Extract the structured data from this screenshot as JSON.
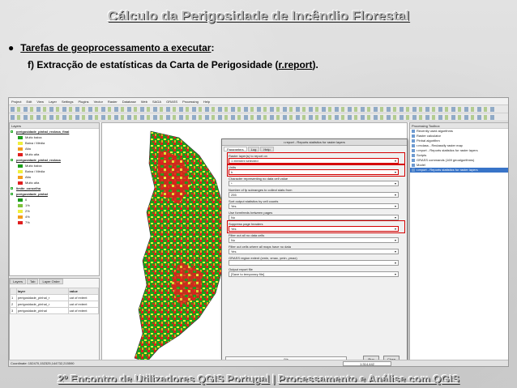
{
  "slide": {
    "title": "Cálculo da Perigosidade de Incêndio Florestal",
    "bullet_link": "Tarefas de geoprocessamento a executar",
    "bullet_suffix": ":",
    "sub_prefix": "f)  Extracção de estatísticas da Carta de Perigosidade (",
    "sub_link": "r.report",
    "sub_suffix": ").",
    "footer_left": "2º Encontro de Utilizadores QGIS Portugal",
    "footer_sep": "|",
    "footer_right": "Processamento e Análise com QGIS"
  },
  "qgis": {
    "menu": [
      "Project",
      "Edit",
      "View",
      "Layer",
      "Settings",
      "Plugins",
      "Vector",
      "Raster",
      "Database",
      "Web",
      "SAGA",
      "GRASS",
      "Processing",
      "Help"
    ],
    "layers_title": "Layers",
    "layers": [
      {
        "name": "perigosidade_pinhal_reclass_final",
        "group": true
      },
      {
        "name": "Muito baixa",
        "color": "#1a9e1a"
      },
      {
        "name": "Baixa / Média",
        "color": "#f0f03c"
      },
      {
        "name": "Alta",
        "color": "#f39c1b"
      },
      {
        "name": "Muito alta",
        "color": "#e01e1e"
      },
      {
        "name": "perigosidade_pinhal_reclass",
        "group": true
      },
      {
        "name": "Muito baixa",
        "color": "#1a9e1a"
      },
      {
        "name": "Baixa / Média",
        "color": "#f0f03c"
      },
      {
        "name": "Alta",
        "color": "#f39c1b"
      },
      {
        "name": "Muito alta",
        "color": "#e01e1e"
      },
      {
        "name": "limite_concelho",
        "group": true
      },
      {
        "name": "perigosidade_pinhal",
        "group": true
      },
      {
        "name": "0",
        "color": "#1a9e1a"
      },
      {
        "name": "1%",
        "color": "#7cc23a"
      },
      {
        "name": "2%",
        "color": "#f0f03c"
      },
      {
        "name": "4%",
        "color": "#f39c1b"
      },
      {
        "name": "7%",
        "color": "#e01e1e"
      }
    ],
    "attr_tabs": [
      "Layers",
      "Tab",
      "Layer Order"
    ],
    "attr_headers": [
      "",
      "layer",
      "value"
    ],
    "attr_rows": [
      [
        "1",
        "perigosidade_pinhal_r",
        "cat of extent"
      ],
      [
        "2",
        "perigosidade_pinhal_r",
        "cat of extent"
      ],
      [
        "3",
        "perigosidade_pinhal",
        "cat of extent"
      ]
    ],
    "dialog": {
      "title": "r.report - Reports statistics for raster layers",
      "tabs": [
        "Parameters",
        "Log",
        "Help"
      ],
      "fields": [
        {
          "label": "Raster layer(s) to report on",
          "value": "1 element selected",
          "hl": true
        },
        {
          "label": "Units",
          "value": "h",
          "hl": true
        },
        {
          "label": "Character representing no data cell value",
          "value": "*"
        },
        {
          "label": "Number of fp subranges to collect stats from",
          "value": "255"
        },
        {
          "label": "Sort output statistics by cell counts",
          "value": "Yes"
        },
        {
          "label": "Use formfeeds between pages",
          "value": "No"
        },
        {
          "label": "Suppress page headers",
          "value": "Yes",
          "hl": true
        },
        {
          "label": "Filter out all no data cells",
          "value": "No"
        },
        {
          "label": "Filter out cells where all maps have no data",
          "value": "Yes"
        },
        {
          "label": "GRASS region extent (xmin, xmax, ymin, ymax)",
          "value": ""
        },
        {
          "label": "Output report file",
          "value": "[Save to temporary file]"
        }
      ],
      "progress": "0%",
      "run_label": "Run",
      "close_label": "Close"
    },
    "toolbox_title": "Processing Toolbox",
    "toolbox": [
      "Recently used algorithms",
      "Raster calculator",
      "Pinhal algorithm",
      "r.reclass - Reclassify raster map",
      "r.report - Reports statistics for raster layers",
      "Scripts",
      "GRASS commands (169 geoalgorithms)",
      "Model",
      "r.report - Reports statistics for raster layers"
    ],
    "toolbox_footer": "Advanced interface",
    "status_coord": "Coordinate: 152470,152325,144732,215590",
    "status_scale": "1:314,442"
  }
}
